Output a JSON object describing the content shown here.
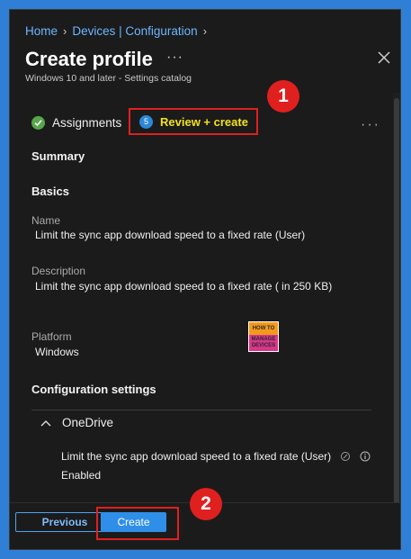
{
  "breadcrumb": {
    "items": [
      "Home",
      "Devices | Configuration"
    ]
  },
  "header": {
    "title": "Create profile",
    "more_label": "···",
    "subtitle": "Windows 10 and later - Settings catalog"
  },
  "steps": [
    {
      "label": "Assignments",
      "state": "complete",
      "icon": "check-circle-icon"
    },
    {
      "number": "5",
      "label": "Review + create",
      "state": "current"
    }
  ],
  "steps_more_label": "···",
  "annotations": [
    "1",
    "2"
  ],
  "summary": {
    "heading": "Summary",
    "basics_heading": "Basics",
    "name_label": "Name",
    "name_value": "Limit the sync app download speed to a fixed rate (User)",
    "description_label": "Description",
    "description_value": "Limit the sync app download speed to a fixed rate ( in 250 KB)",
    "platform_label": "Platform",
    "platform_value": "Windows"
  },
  "watermark": {
    "line1": "HOW TO",
    "line2": "MANAGE",
    "line3": "DEVICES"
  },
  "configuration": {
    "heading": "Configuration settings",
    "group_label": "OneDrive",
    "setting_label": "Limit the sync app download speed to a fixed rate (User)",
    "setting_value": "Enabled"
  },
  "footer": {
    "previous_label": "Previous",
    "create_label": "Create"
  },
  "colors": {
    "accent": "#2f8fe8",
    "annotation_red": "#e0201f",
    "highlight_text": "#f4e21c",
    "complete_green": "#57a64a"
  }
}
